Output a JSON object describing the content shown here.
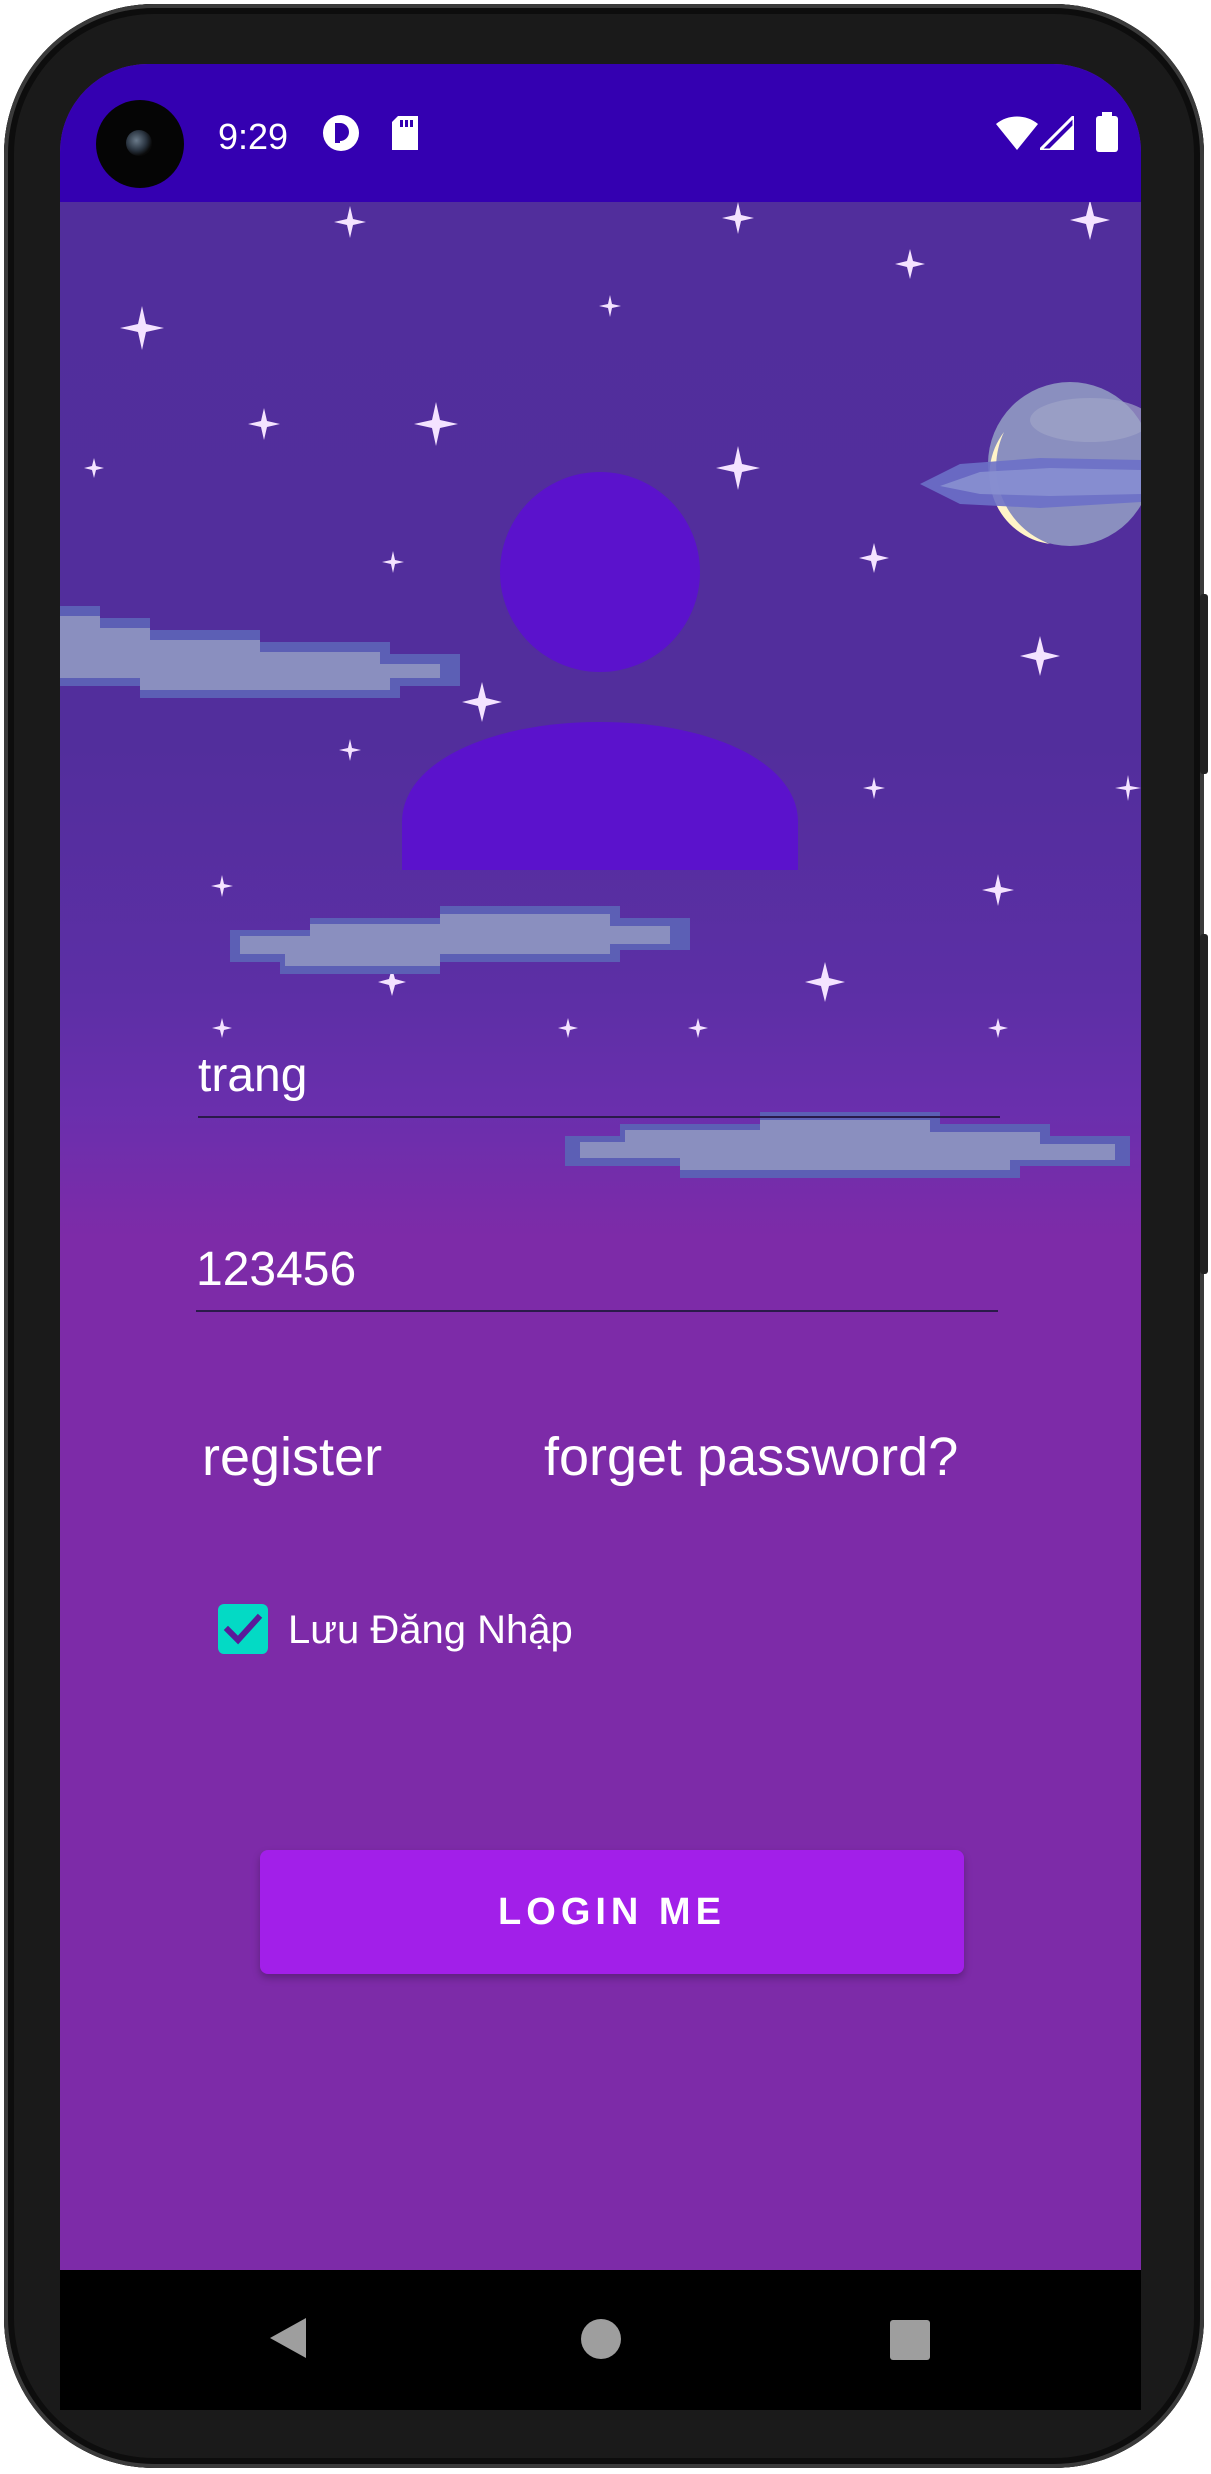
{
  "status_bar": {
    "time": "9:29",
    "icons": [
      "camera-icon",
      "app-notification-icon",
      "sd-card-icon",
      "wifi-icon",
      "signal-icon",
      "battery-icon"
    ]
  },
  "login_form": {
    "username_value": "trang",
    "password_value": "123456",
    "register_label": "register",
    "forget_password_label": "forget password?",
    "remember_label": "Lưu Đăng Nhập",
    "remember_checked": true,
    "login_button_label": "LOGIN ME"
  },
  "navigation": {
    "icons": [
      "back-icon",
      "home-icon",
      "recents-icon"
    ]
  },
  "colors": {
    "status_bar": "#3400b1",
    "background_top": "#512e9c",
    "background_bottom": "#7d2ba8",
    "avatar": "#5b12cc",
    "accent_checkbox": "#03dac5",
    "button": "#a21fe9"
  }
}
